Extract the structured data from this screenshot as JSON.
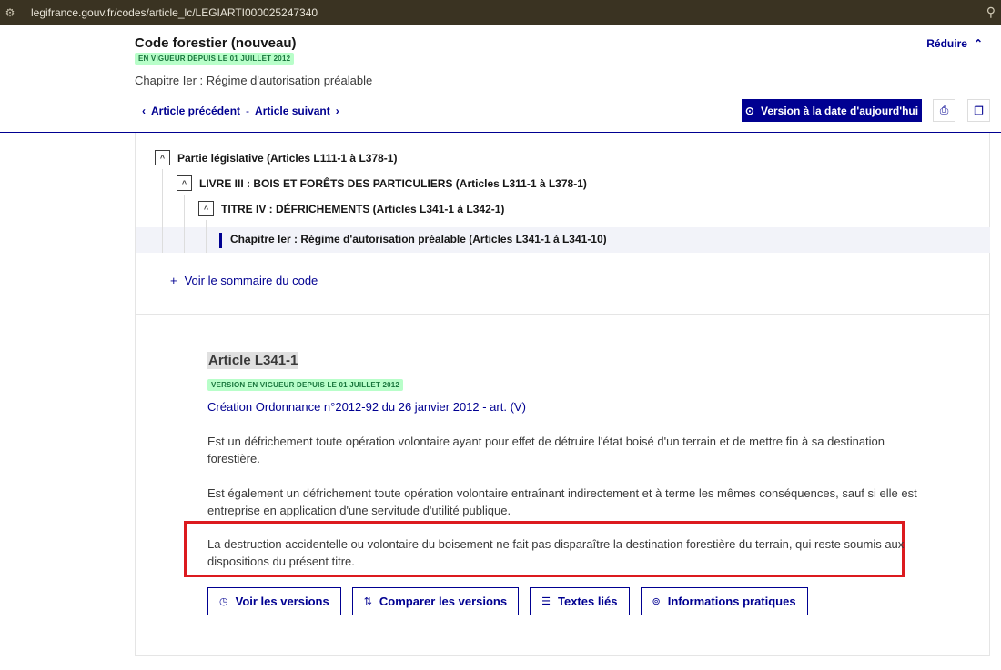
{
  "browser": {
    "url": "legifrance.gouv.fr/codes/article_lc/LEGIARTI000025247340"
  },
  "header": {
    "code_title": "Code forestier (nouveau)",
    "badge": "EN VIGUEUR DEPUIS LE 01 JUILLET 2012",
    "chapter": "Chapitre Ier : Régime d'autorisation préalable",
    "reduire": "Réduire",
    "prev": "Article précédent",
    "sep": "-",
    "next": "Article suivant",
    "version_button": "Version à la date d'aujourd'hui"
  },
  "tree": {
    "items": [
      {
        "label": "Partie législative (Articles L111-1 à L378-1)",
        "toggle": "^"
      },
      {
        "label": "LIVRE III : BOIS ET FORÊTS DES PARTICULIERS (Articles L311-1 à L378-1)",
        "toggle": "^"
      },
      {
        "label": "TITRE IV : DÉFRICHEMENTS (Articles L341-1 à L342-1)",
        "toggle": "^"
      },
      {
        "label": "Chapitre Ier : Régime d'autorisation préalable (Articles L341-1 à L341-10)"
      }
    ],
    "sommaire": "Voir le sommaire du code",
    "sommaire_prefix": "+"
  },
  "article": {
    "title": "Article L341-1",
    "badge": "VERSION EN VIGUEUR DEPUIS LE 01 JUILLET 2012",
    "creation": "Création Ordonnance n°2012-92 du 26 janvier 2012 - art. (V)",
    "paragraphs": [
      "Est un défrichement toute opération volontaire ayant pour effet de détruire l'état boisé d'un terrain et de mettre fin à sa destination forestière.",
      "Est également un défrichement toute opération volontaire entraînant indirectement et à terme les mêmes conséquences, sauf si elle est entreprise en application d'une servitude d'utilité publique.",
      "La destruction accidentelle ou volontaire du boisement ne fait pas disparaître la destination forestière du terrain, qui reste soumis aux dispositions du présent titre."
    ],
    "actions": [
      {
        "label": "Voir les versions",
        "icon": "clock-icon"
      },
      {
        "label": "Comparer les versions",
        "icon": "compare-icon"
      },
      {
        "label": "Textes liés",
        "icon": "list-icon"
      },
      {
        "label": "Informations pratiques",
        "icon": "help-icon"
      }
    ]
  },
  "colors": {
    "primary": "#000091",
    "badge_bg": "#b8fec9",
    "badge_fg": "#18753c",
    "highlight": "#dc1a1f"
  }
}
